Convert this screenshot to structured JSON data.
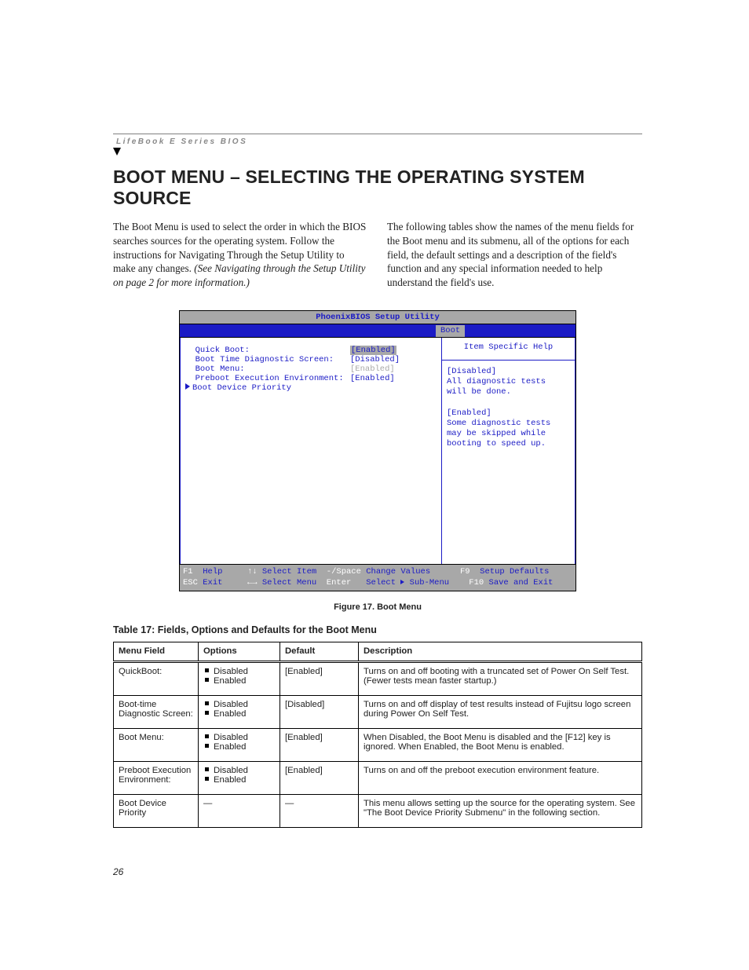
{
  "header": {
    "series": "LifeBook E Series BIOS"
  },
  "title": "BOOT MENU – SELECTING THE OPERATING SYSTEM SOURCE",
  "intro": {
    "left_plain": "The Boot Menu is used to select the order in which the BIOS searches sources for the operating system. Follow the instructions for Navigating Through the Setup Utility to make any changes. ",
    "left_italic": "(See Navigating through the Setup Utility on page 2 for more information.)",
    "right": "The following tables show the names of the menu fields for the Boot menu and its submenu, all of the options for each field, the default settings and a description of the field's function and any special information needed to help understand the field's use."
  },
  "bios": {
    "title": "PhoenixBIOS Setup Utility",
    "tab": "Boot",
    "rows": [
      {
        "label": "  Quick Boot:",
        "value": "[Enabled]",
        "highlight": true,
        "dim": false
      },
      {
        "label": "  Boot Time Diagnostic Screen:",
        "value": "[Disabled]",
        "highlight": false,
        "dim": false
      },
      {
        "label": "  Boot Menu:",
        "value": "[Enabled]",
        "highlight": false,
        "dim": true
      },
      {
        "label": "  Preboot Execution Environment:",
        "value": "[Enabled]",
        "highlight": false,
        "dim": false
      }
    ],
    "submenu": "Boot Device Priority",
    "help": {
      "title": "Item Specific Help",
      "lines": [
        "[Disabled]",
        "All diagnostic tests",
        "will be done.",
        "",
        "[Enabled]",
        "Some diagnostic tests",
        "may be skipped while",
        "booting to speed up."
      ]
    },
    "footer": {
      "l1": {
        "k1": "F1",
        "t1": "Help",
        "k2": "↑↓",
        "t2": "Select Item",
        "k3": "-/Space",
        "t3": "Change Values",
        "k4": "F9",
        "t4": "Setup Defaults"
      },
      "l2": {
        "k1": "ESC",
        "t1": "Exit",
        "k2": "←→",
        "t2": "Select Menu",
        "k3": "Enter",
        "t3": "Select",
        "tri": "▶",
        "t3b": "Sub-Menu",
        "k4": "F10",
        "t4": "Save and Exit"
      }
    }
  },
  "figure_caption": "Figure 17.  Boot Menu",
  "table_caption": "Table 17: Fields, Options and Defaults for the Boot Menu",
  "table_headers": {
    "field": "Menu Field",
    "options": "Options",
    "def": "Default",
    "desc": "Description"
  },
  "table_rows": [
    {
      "field": "QuickBoot:",
      "options": [
        "Disabled",
        "Enabled"
      ],
      "def": "[Enabled]",
      "desc": "Turns on and off booting with a truncated set of Power On Self Test. (Fewer tests mean faster startup.)"
    },
    {
      "field": "Boot-time Diagnostic Screen:",
      "options": [
        "Disabled",
        "Enabled"
      ],
      "def": "[Disabled]",
      "desc": "Turns on and off display of test results instead of Fujitsu logo screen during Power On Self Test."
    },
    {
      "field": "Boot Menu:",
      "options": [
        "Disabled",
        "Enabled"
      ],
      "def": "[Enabled]",
      "desc": "When Disabled, the Boot Menu is disabled and the [F12] key is ignored. When Enabled, the Boot Menu is enabled."
    },
    {
      "field": "Preboot Execution Environment:",
      "options": [
        "Disabled",
        "Enabled"
      ],
      "def": "[Enabled]",
      "desc": "Turns on and off the preboot execution environment feature."
    },
    {
      "field": "Boot Device Priority",
      "options": [],
      "def": "—",
      "desc": "This menu allows setting up the source for the operating system. See \"The Boot Device Priority Submenu\" in the following section."
    }
  ],
  "page_number": "26"
}
